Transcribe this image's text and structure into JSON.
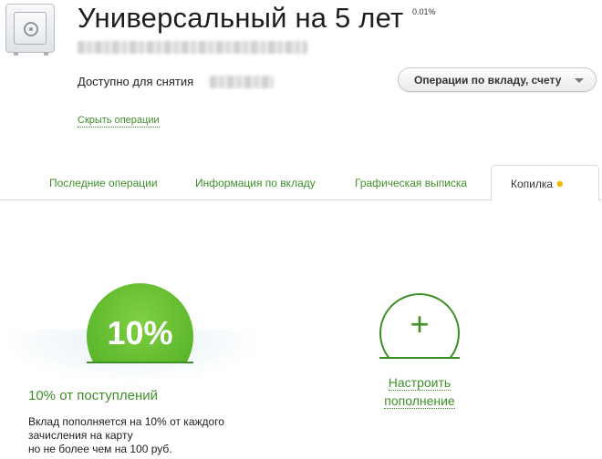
{
  "deposit": {
    "title": "Универсальный на 5 лет",
    "rate": "0.01%",
    "available_label": "Доступно для снятия"
  },
  "operations_button": {
    "label": "Операции по вкладу, счету"
  },
  "hide_operations_link": "Скрыть операции",
  "tabs": [
    {
      "label": "Последние операции",
      "active": false
    },
    {
      "label": "Информация по вкладу",
      "active": false
    },
    {
      "label": "Графическая выписка",
      "active": false
    },
    {
      "label": "Копилка",
      "active": true
    }
  ],
  "piggy_bank": {
    "percent_badge": "10%",
    "rule_title": "10% от поступлений",
    "rule_description": [
      "Вклад пополняется на 10% от каждого",
      "зачисления на карту",
      "но не более чем на 100 руб."
    ],
    "configure": {
      "plus": "+",
      "line1": "Настроить",
      "line2": "пополнение"
    }
  },
  "colors": {
    "accent_green": "#3f8f2a",
    "badge_green": "#5bb52a",
    "star": "#f0b400"
  },
  "icons": [
    "safe-icon",
    "star-icon",
    "chevron-down-icon",
    "plus-icon"
  ]
}
